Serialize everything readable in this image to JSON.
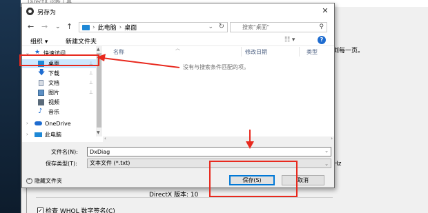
{
  "background": {
    "window_title": "DirectX 诊断工具",
    "right_text": "浏每一页。",
    "hz_text": "Hz",
    "directx_version": "DirectX 版本: 10",
    "whql_checkbox_label": "检查 WHQL 数字签名(C)",
    "whql_checked": true
  },
  "dialog": {
    "title": "另存为",
    "close_glyph": "✕",
    "nav": {
      "back_glyph": "←",
      "forward_glyph": "→",
      "dropdown_glyph": "⌄",
      "up_glyph": "↑",
      "breadcrumb": [
        "此电脑",
        "桌面"
      ],
      "breadcrumb_sep": "›",
      "refresh_glyph": "↻",
      "search_placeholder": "搜索\"桌面\"",
      "search_icon": "search-icon"
    },
    "toolbar": {
      "organize_label": "组织 ▾",
      "new_folder_label": "新建文件夹",
      "view_glyph": "☷ ▾",
      "help_glyph": "?"
    },
    "sidebar": {
      "items": [
        {
          "label": "快速访问",
          "icon": "star-icon",
          "expanded": true
        },
        {
          "label": "桌面",
          "icon": "desktop-icon",
          "pinned": true,
          "selected": true
        },
        {
          "label": "下载",
          "icon": "download-icon",
          "pinned": true
        },
        {
          "label": "文档",
          "icon": "document-icon",
          "pinned": true
        },
        {
          "label": "图片",
          "icon": "picture-icon",
          "pinned": true
        },
        {
          "label": "视频",
          "icon": "video-icon"
        },
        {
          "label": "音乐",
          "icon": "music-icon"
        },
        {
          "label": "OneDrive",
          "icon": "cloud-icon",
          "expanded": false
        },
        {
          "label": "此电脑",
          "icon": "computer-icon",
          "expanded": false
        }
      ],
      "pin_glyph": "📌"
    },
    "file_pane": {
      "columns": [
        "名称",
        "修改日期",
        "类型"
      ],
      "empty_message": "没有与搜索条件匹配的项。"
    },
    "form": {
      "filename_label": "文件名(N):",
      "filename_value": "DxDiag",
      "filetype_label": "保存类型(T):",
      "filetype_value": "文本文件 (*.txt)",
      "hide_folders_label": "隐藏文件夹",
      "save_label": "保存(S)",
      "cancel_label": "取消"
    }
  },
  "colors": {
    "annotation_red": "#e8291e",
    "selection_blue": "#cce8ff",
    "accent_blue": "#0078d7"
  }
}
